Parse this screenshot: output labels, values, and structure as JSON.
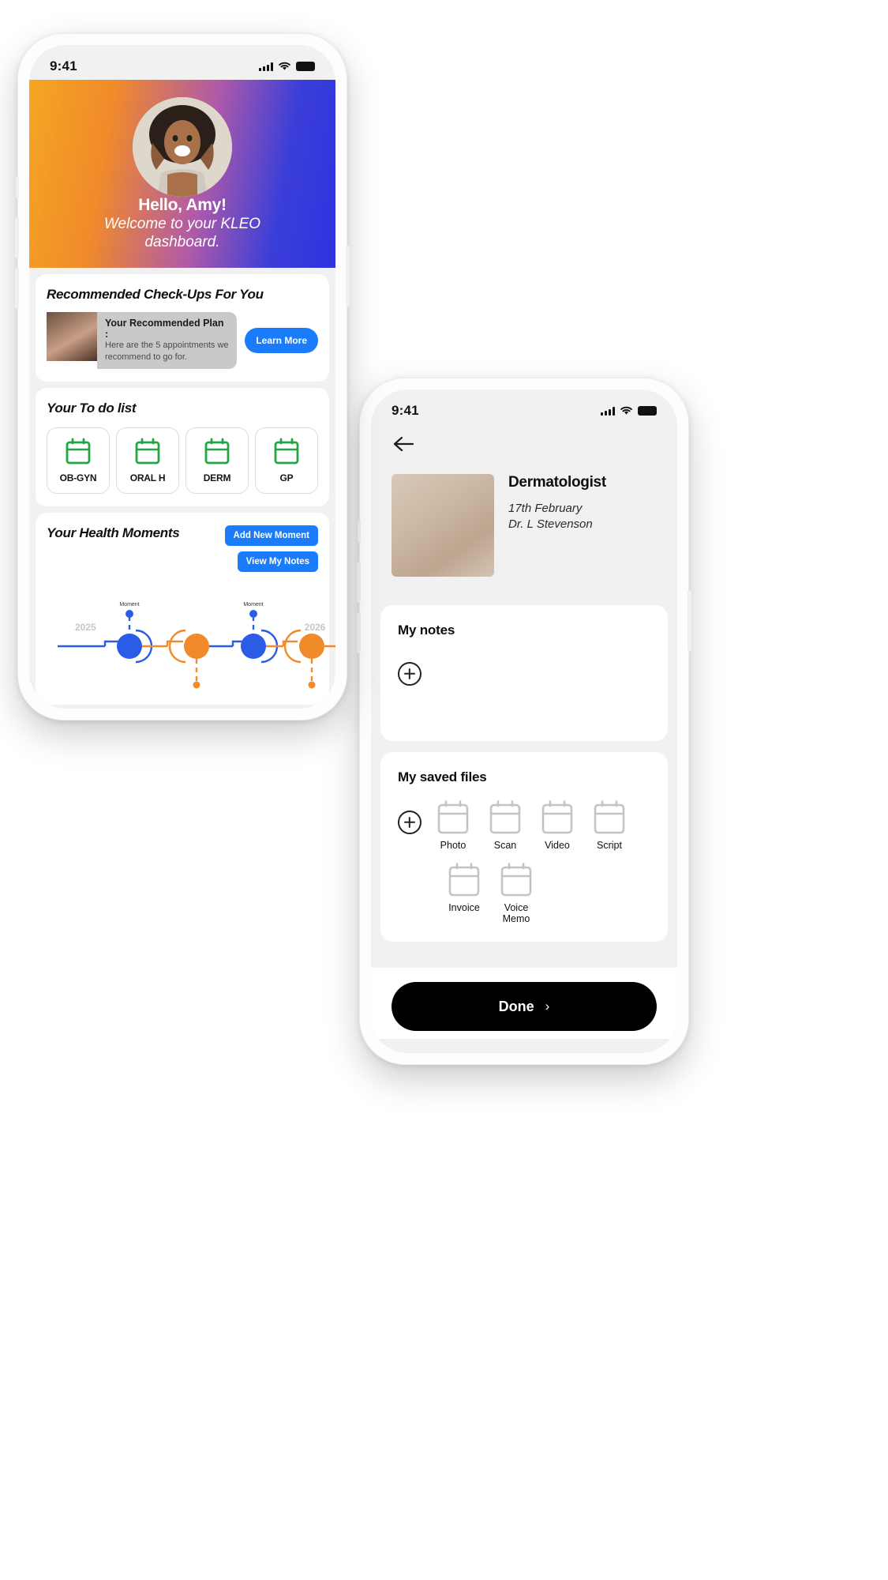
{
  "phone1": {
    "status": {
      "time": "9:41",
      "signal_icon": "signal-bars-icon",
      "wifi_icon": "wifi-icon",
      "battery_icon": "battery-icon"
    },
    "hero": {
      "greeting": "Hello, Amy!",
      "subtitle_line1": "Welcome to your KLEO",
      "subtitle_line2": "dashboard.",
      "avatar_icon": "user-portrait-avatar",
      "gradient_from": "#f5a623",
      "gradient_to": "#2f31e0"
    },
    "checkups": {
      "title": "Recommended Check-Ups For You",
      "plan_title": "Your Recommended Plan :",
      "plan_desc_line1": "Here are the 5 appointments we",
      "plan_desc_line2": "recommend to go for.",
      "learn_more_label": "Learn More",
      "accent": "#1a7cfa"
    },
    "todo": {
      "title": "Your To do list",
      "items": [
        {
          "label": "OB-GYN",
          "icon": "calendar-icon"
        },
        {
          "label": "ORAL H",
          "icon": "calendar-icon"
        },
        {
          "label": "DERM",
          "icon": "calendar-icon"
        },
        {
          "label": "GP",
          "icon": "calendar-icon"
        }
      ],
      "icon_color": "#22a646"
    },
    "moments": {
      "title": "Your Health Moments",
      "add_label": "Add New Moment",
      "view_label": "View My Notes",
      "timeline": {
        "start_year": "2025",
        "end_year": "2026",
        "moment_label": "Moment",
        "blue": "#2b5ce6",
        "orange": "#f08a2a",
        "nodes": [
          {
            "color": "blue",
            "label": "Moment",
            "label_pos": "top"
          },
          {
            "color": "orange",
            "label": "",
            "label_pos": "bottom"
          },
          {
            "color": "blue",
            "label": "Moment",
            "label_pos": "top"
          },
          {
            "color": "orange",
            "label": "",
            "label_pos": "bottom"
          }
        ]
      }
    }
  },
  "phone2": {
    "status": {
      "time": "9:41",
      "signal_icon": "signal-bars-icon",
      "wifi_icon": "wifi-icon",
      "battery_icon": "battery-icon"
    },
    "back_icon": "back-arrow-icon",
    "appointment": {
      "title": "Dermatologist",
      "date": "17th February",
      "doctor": "Dr. L Stevenson",
      "thumb_icon": "appointment-photo"
    },
    "notes": {
      "title": "My notes",
      "add_icon": "plus-circle-icon"
    },
    "files": {
      "title": "My saved files",
      "add_icon": "plus-circle-icon",
      "items": [
        {
          "label": "Photo",
          "icon": "file-icon"
        },
        {
          "label": "Scan",
          "icon": "file-icon"
        },
        {
          "label": "Video",
          "icon": "file-icon"
        },
        {
          "label": "Script",
          "icon": "file-icon"
        },
        {
          "label": "Invoice",
          "icon": "file-icon"
        },
        {
          "label": "Voice Memo",
          "icon": "file-icon"
        }
      ]
    },
    "done": {
      "label": "Done",
      "chevron": "›"
    }
  }
}
